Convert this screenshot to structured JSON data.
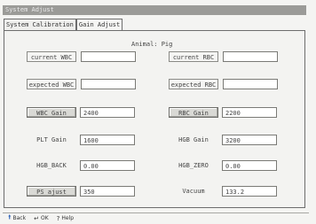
{
  "window": {
    "title": "System Adjust"
  },
  "tabs": [
    {
      "label": "System Calibration"
    },
    {
      "label": "Gain Adjust"
    }
  ],
  "animal_label": "Animal: Pig",
  "left_rows": [
    {
      "label": "current WBC",
      "value": ""
    },
    {
      "label": "expected WBC",
      "value": ""
    },
    {
      "label": "WBC Gain",
      "value": "2400"
    },
    {
      "label": "PLT Gain",
      "value": "1600"
    },
    {
      "label": "HGB_BACK",
      "value": "0.00"
    },
    {
      "label": "PS ajust",
      "value": "350"
    }
  ],
  "right_rows": [
    {
      "label": "current RBC",
      "value": ""
    },
    {
      "label": "expected RBC",
      "value": ""
    },
    {
      "label": "RBC Gain",
      "value": "2200"
    },
    {
      "label": "HGB Gain",
      "value": "3200"
    },
    {
      "label": "HGB_ZERO",
      "value": "0.00"
    },
    {
      "label": "Vacuum",
      "value": "133.2"
    }
  ],
  "statusbar": {
    "back": {
      "icon": "back-arrow-icon",
      "label": "Back"
    },
    "ok": {
      "icon": "ok-icon",
      "label": "OK"
    },
    "help": {
      "icon": "help-icon",
      "label": "Help"
    }
  }
}
